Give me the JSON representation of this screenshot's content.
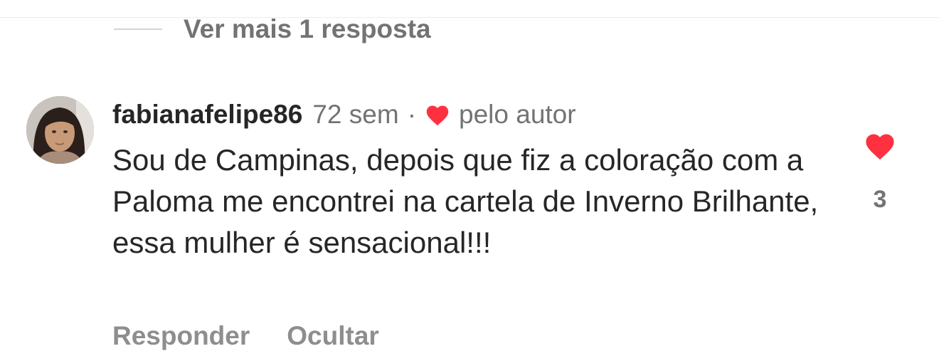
{
  "more_replies": {
    "label": "Ver mais 1 resposta"
  },
  "comment": {
    "username": "fabianafelipe86",
    "time": "72 sem",
    "separator": "·",
    "by_author": "pelo autor",
    "text": "Sou de Campinas, depois que fiz a coloração com a Paloma me encontrei na cartela de Inverno Brilhante, essa mulher é sensacional!!!",
    "like_count": "3"
  },
  "actions": {
    "reply": "Responder",
    "hide": "Ocultar"
  },
  "colors": {
    "heart": "#ff3040",
    "primary_text": "#262626",
    "secondary_text": "#737373"
  },
  "icons": {
    "author_like": "heart-icon",
    "like": "heart-icon"
  }
}
